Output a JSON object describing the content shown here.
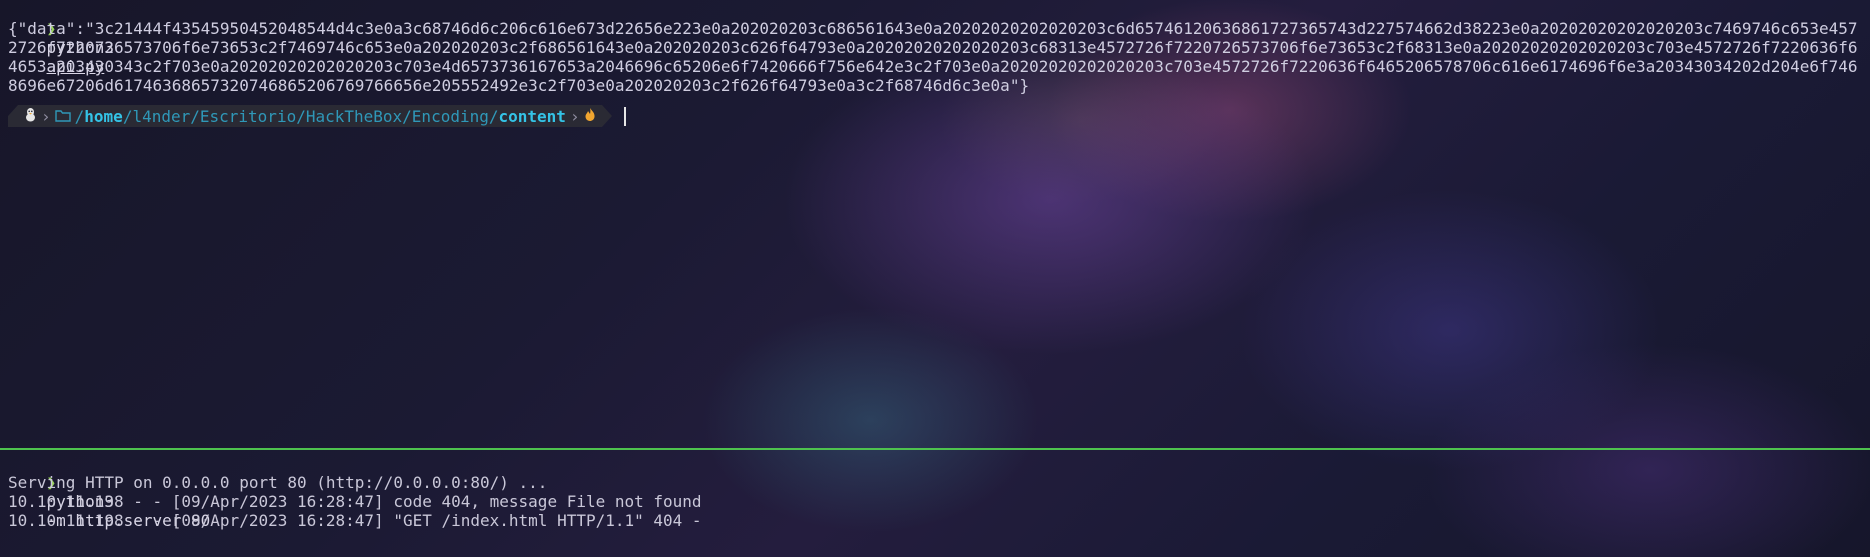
{
  "top_pane": {
    "prompt_symbol": "❯",
    "command": "python3",
    "command_arg": "api.py",
    "output": "{\"data\":\"3c21444f43545950452048544d4c3e0a3c68746d6c206c616e673d22656e223e0a202020203c686561643e0a20202020202020203c6d65746120636861727365743d227574662d38223e0a20202020202020203c7469746c653e4572726f7220726573706f6e73653c2f7469746c653e0a202020203c2f686561643e0a202020203c626f64793e0a20202020202020203c68313e4572726f7220726573706f6e73653c2f68313e0a20202020202020203c703e4572726f7220636f64653a203430343c2f703e0a20202020202020203c703e4d6573736167653a2046696c65206e6f7420666f756e642e3c2f703e0a20202020202020203c703e4572726f7220636f6465206578706c616e6174696f6e3a20343034202d204e6f7468696e67206d61746368657320746865206769766656e205552492e3c2f703e0a202020203c2f626f64793e0a3c2f68746d6c3e0a\"}",
    "ps1": {
      "os_icon": "tux-icon",
      "folder_icon": "folder-icon",
      "path_prefix": "/",
      "path_parts": [
        "home",
        "/l4nder/Escritorio/HackTheBox/Encoding/",
        "content"
      ],
      "status_icon": "fire-icon"
    }
  },
  "bottom_pane": {
    "prompt_symbol": "❯",
    "command": "python3",
    "command_args": "-m http.server 80",
    "lines": [
      "Serving HTTP on 0.0.0.0 port 80 (http://0.0.0.0:80/) ...",
      "10.10.11.198 - - [09/Apr/2023 16:28:47] code 404, message File not found",
      "10.10.11.198 - - [09/Apr/2023 16:28:47] \"GET /index.html HTTP/1.1\" 404 -"
    ]
  },
  "colors": {
    "prompt_arrow": "#9ad35a",
    "divider": "#4ec24e",
    "path": "#34c3e6"
  }
}
